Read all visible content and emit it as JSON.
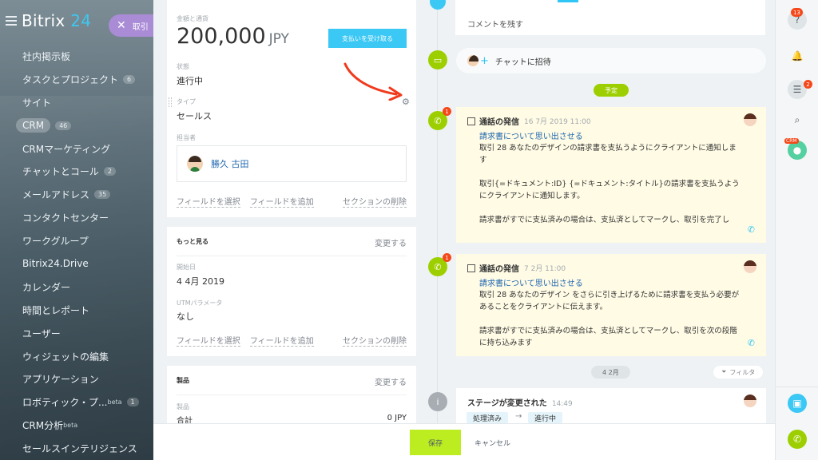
{
  "sidebar": {
    "logo_text": "Bitrix",
    "logo_num": "24",
    "deal_pill": "取引",
    "items": [
      {
        "label": "社内掲示板"
      },
      {
        "label": "タスクとプロジェクト",
        "badge": "6"
      },
      {
        "label": "サイト"
      },
      {
        "label": "CRM",
        "badge": "46",
        "active": true
      },
      {
        "label": "CRMマーケティング"
      },
      {
        "label": "チャットとコール",
        "badge": "2"
      },
      {
        "label": "メールアドレス",
        "badge": "35"
      },
      {
        "label": "コンタクトセンター"
      },
      {
        "label": "ワークグループ"
      },
      {
        "label": "Bitrix24.Drive"
      },
      {
        "label": "カレンダー"
      },
      {
        "label": "時間とレポート"
      },
      {
        "label": "ユーザー"
      },
      {
        "label": "ウィジェットの編集"
      },
      {
        "label": "アプリケーション"
      },
      {
        "label": "ロボティック・プ...",
        "sup": "beta",
        "badge": "1"
      },
      {
        "label": "CRM分析",
        "sup": "beta"
      },
      {
        "label": "セールスインテリジェンス"
      }
    ]
  },
  "deal_card": {
    "amount_label": "金額と通貨",
    "amount": "200,000",
    "currency": "JPY",
    "pay_button": "支払いを受け取る",
    "status_label": "状態",
    "status_value": "進行中",
    "type_label": "タイプ",
    "type_value": "セールス",
    "assignee_label": "担当者",
    "assignee_name": "勝久 古田",
    "select_field": "フィールドを選択",
    "add_field": "フィールドを追加",
    "delete_section": "セクションの削除"
  },
  "more_card": {
    "title": "もっと見る",
    "edit": "変更する",
    "start_label": "開始日",
    "start_value": "4 4月 2019",
    "utm_label": "UTMパラメータ",
    "utm_value": "なし",
    "select_field": "フィールドを選択",
    "add_field": "フィールドを追加",
    "delete_section": "セクションの削除"
  },
  "products_card": {
    "title": "製品",
    "edit": "変更する",
    "products_label": "製品",
    "total_label": "合計",
    "total_value": "0 JPY"
  },
  "timeline": {
    "comment_placeholder": "コメントを残す",
    "chat_invite": "チャットに招待",
    "planned_pill": "予定",
    "month_pill": "4 2月",
    "filter_label": "フィルタ",
    "calls": [
      {
        "title": "通話の発信",
        "time": "16 7月 2019 11:00",
        "link": "請求書について思い出させる",
        "body": "取引 28 あなたのデザインの請求書を支払うようにクライアントに通知します\n\n取引{=ドキュメント:ID} {=ドキュメント:タイトル}の請求書を支払うようにクライアントに通知します。\n\n請求書がすでに支払済みの場合は、支払済としてマークし、取引を完了し",
        "badge": "1"
      },
      {
        "title": "通話の発信",
        "time": "7 2月 11:00",
        "link": "請求書について思い出させる",
        "body": "取引 28 あなたのデザイン をさらに引き上げるために請求書を支払う必要があることをクライアントに伝えます。\n\n請求書がすでに支払済みの場合は、支払済としてマークし、取引を次の段階に持ち込みます",
        "badge": "1"
      }
    ],
    "stage_change": {
      "title": "ステージが変更された",
      "time": "14:49",
      "from": "処理済み",
      "to": "進行中"
    }
  },
  "rightbar": {
    "help_badge": "13",
    "chat_badge": "2",
    "crm_tag": "CRM"
  },
  "bottombar": {
    "save": "保存",
    "cancel": "キャンセル"
  },
  "colors": {
    "accent_blue": "#3bc8f5",
    "green": "#9dcf00",
    "save_green": "#bbed21",
    "badge_red": "#f54819",
    "link_blue": "#2067b0"
  }
}
